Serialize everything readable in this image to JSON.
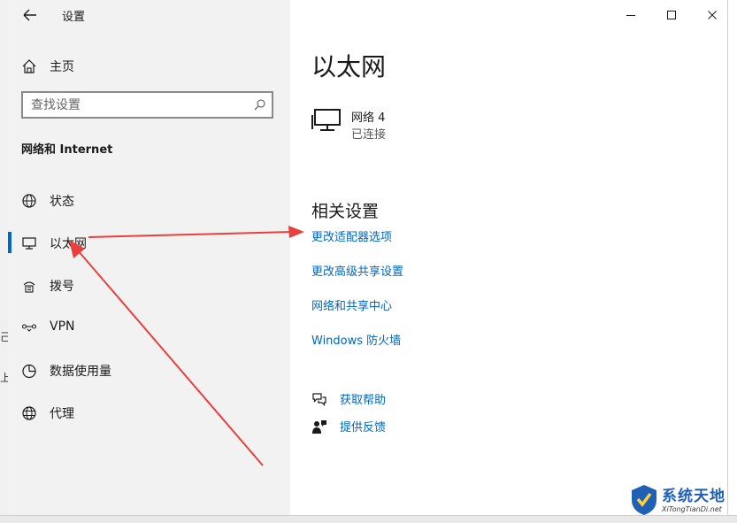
{
  "window": {
    "title": "设置",
    "controls": {
      "minimize_icon": "minimize-icon",
      "maximize_icon": "maximize-icon",
      "close_icon": "close-icon"
    }
  },
  "sidebar": {
    "home_label": "主页",
    "search_placeholder": "查找设置",
    "section_title": "网络和 Internet",
    "items": [
      {
        "label": "状态",
        "icon": "globe-status-icon",
        "active": false
      },
      {
        "label": "以太网",
        "icon": "ethernet-icon",
        "active": true
      },
      {
        "label": "拨号",
        "icon": "dial-up-icon",
        "active": false
      },
      {
        "label": "VPN",
        "icon": "vpn-icon",
        "active": false
      },
      {
        "label": "数据使用量",
        "icon": "data-usage-icon",
        "active": false
      },
      {
        "label": "代理",
        "icon": "proxy-globe-icon",
        "active": false
      }
    ]
  },
  "main": {
    "title": "以太网",
    "network": {
      "name": "网络 4",
      "status": "已连接",
      "icon": "ethernet-monitor-icon"
    },
    "related_heading": "相关设置",
    "links": [
      "更改适配器选项",
      "更改高级共享设置",
      "网络和共享中心",
      "Windows 防火墙"
    ],
    "help": [
      {
        "label": "获取帮助",
        "icon": "help-chat-icon"
      },
      {
        "label": "提供反馈",
        "icon": "feedback-icon"
      }
    ]
  },
  "background_fragments": {
    "char1": "己",
    "char2": "上"
  },
  "watermark": {
    "title": "系统天地",
    "subtitle": "XiTongTianDi.net"
  },
  "colors": {
    "accent": "#0067c0",
    "annotation_arrow": "#e8413d",
    "sidebar_bg": "#f2f2f2"
  }
}
